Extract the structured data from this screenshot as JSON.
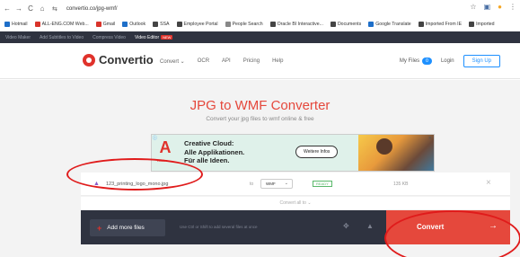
{
  "browser": {
    "url": "convertio.co/jpg-wmf/",
    "back_icon": "←",
    "forward_icon": "→",
    "reload_icon": "C",
    "home_icon": "⌂",
    "site_icon": "⇆",
    "star_icon": "☆",
    "menu_icon": "⋮"
  },
  "bookmarks": [
    {
      "label": "Hotmail",
      "color": "#1e6fc9"
    },
    {
      "label": "ALL-ENG.COM Web...",
      "color": "#d9342b"
    },
    {
      "label": "Gmail",
      "color": "#d9342b"
    },
    {
      "label": "Outlook",
      "color": "#1e6fc9"
    },
    {
      "label": "SSA",
      "color": "#444"
    },
    {
      "label": "Employee Portal",
      "color": "#444"
    },
    {
      "label": "People Search",
      "color": "#888"
    },
    {
      "label": "Oracle BI Interactive...",
      "color": "#444"
    },
    {
      "label": "Documents",
      "color": "#444"
    },
    {
      "label": "Google Translate",
      "color": "#1e6fc9"
    },
    {
      "label": "Imported From IE",
      "color": "#444"
    },
    {
      "label": "Imported",
      "color": "#444"
    }
  ],
  "video_strip": {
    "items": [
      "Video Maker",
      "Add Subtitles to Video",
      "Compress Video"
    ],
    "active": "Video Editor",
    "badge": "NEW"
  },
  "header": {
    "logo": "Convertio",
    "nav": [
      "Convert ⌄",
      "OCR",
      "API",
      "Pricing",
      "Help"
    ],
    "my_files": "My Files",
    "my_files_count": "0",
    "login": "Login",
    "signup": "Sign Up"
  },
  "hero": {
    "title": "JPG to WMF Converter",
    "subtitle": "Convert your jpg files to wmf online & free"
  },
  "ad": {
    "brand": "Adobe",
    "line1": "Creative Cloud:",
    "line2": "Alle Applikationen.",
    "line3": "Für alle Ideen.",
    "button": "Weitere Infos"
  },
  "file": {
    "name": "123_printing_logo_mono.jpg",
    "to_label": "to",
    "format": "WMF",
    "status": "READY",
    "size": "135 KB",
    "remove": "×"
  },
  "convert_all": "Convert all to ⌄",
  "actions": {
    "add_files": "Add more files",
    "hint": "Use Ctrl or Shift to add several files at once",
    "convert": "Convert",
    "convert_arrow": "→"
  },
  "colors": {
    "accent_red": "#e5483c",
    "dark_bar": "#2f3340",
    "annotation": "#e01b1b"
  }
}
